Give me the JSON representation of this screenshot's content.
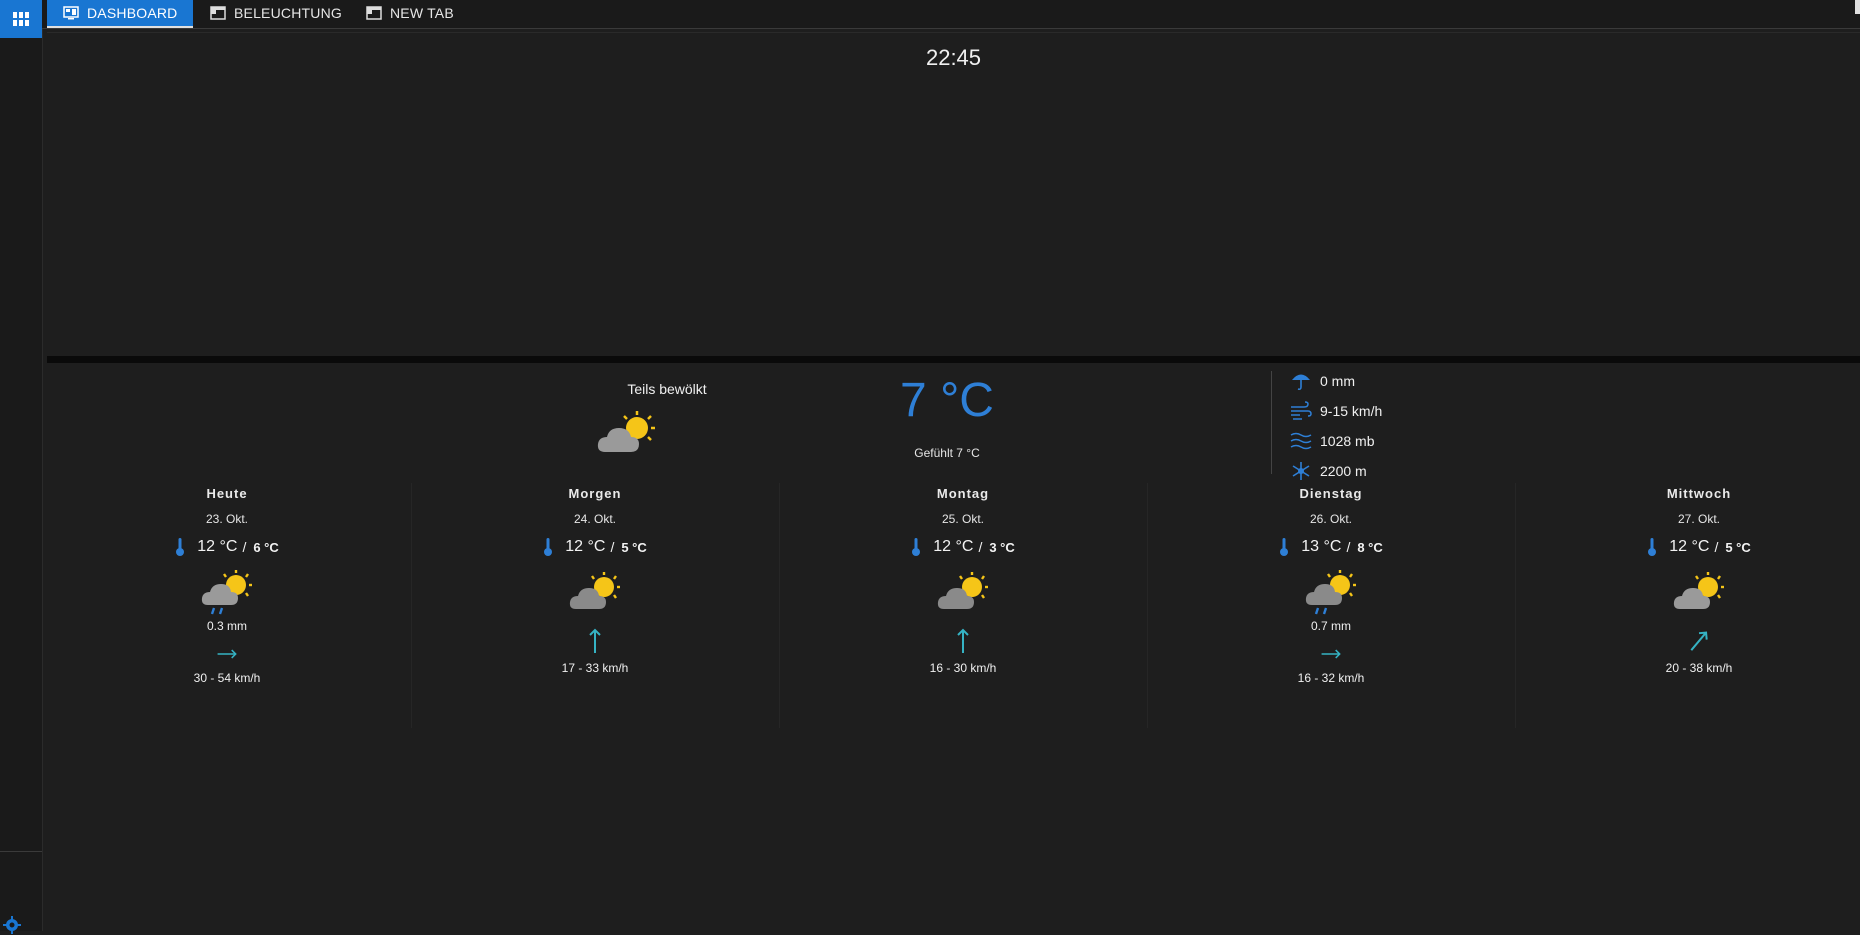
{
  "tabs": [
    {
      "label": "DASHBOARD",
      "active": true
    },
    {
      "label": "BELEUCHTUNG",
      "active": false
    },
    {
      "label": "NEW TAB",
      "active": false
    }
  ],
  "clock": {
    "time": "22:45"
  },
  "current": {
    "condition": "Teils bewölkt",
    "icon": "partly-cloudy-icon",
    "temp": "7 °C",
    "feels_like": "Gefühlt 7 °C",
    "precipitation": "0 mm",
    "wind": "9-15 km/h",
    "pressure": "1028 mb",
    "snow_line": "2200 m"
  },
  "forecast": [
    {
      "day": "Heute",
      "date": "23. Okt.",
      "high": "12 °C",
      "low": "6 °C",
      "icon": "rain-partly-cloudy-icon",
      "rain": "0.3 mm",
      "wind_dir_deg": 90,
      "wind": "30 - 54 km/h"
    },
    {
      "day": "Morgen",
      "date": "24. Okt.",
      "high": "12 °C",
      "low": "5 °C",
      "icon": "partly-cloudy-icon",
      "rain": "",
      "wind_dir_deg": 0,
      "wind": "17 - 33 km/h"
    },
    {
      "day": "Montag",
      "date": "25. Okt.",
      "high": "12 °C",
      "low": "3 °C",
      "icon": "partly-cloudy-icon",
      "rain": "",
      "wind_dir_deg": 0,
      "wind": "16 - 30 km/h"
    },
    {
      "day": "Dienstag",
      "date": "26. Okt.",
      "high": "13 °C",
      "low": "8 °C",
      "icon": "rain-partly-cloudy-icon",
      "rain": "0.7 mm",
      "wind_dir_deg": 90,
      "wind": "16 - 32 km/h"
    },
    {
      "day": "Mittwoch",
      "date": "27. Okt.",
      "high": "12 °C",
      "low": "5 °C",
      "icon": "partly-cloudy-icon",
      "rain": "",
      "wind_dir_deg": 40,
      "wind": "20 - 38 km/h"
    }
  ],
  "colors": {
    "accent": "#1976d2",
    "temp_blue": "#2e7fd6",
    "sun": "#f5c518",
    "cloud": "#9a9a9a",
    "wind_teal": "#35b3c4"
  }
}
